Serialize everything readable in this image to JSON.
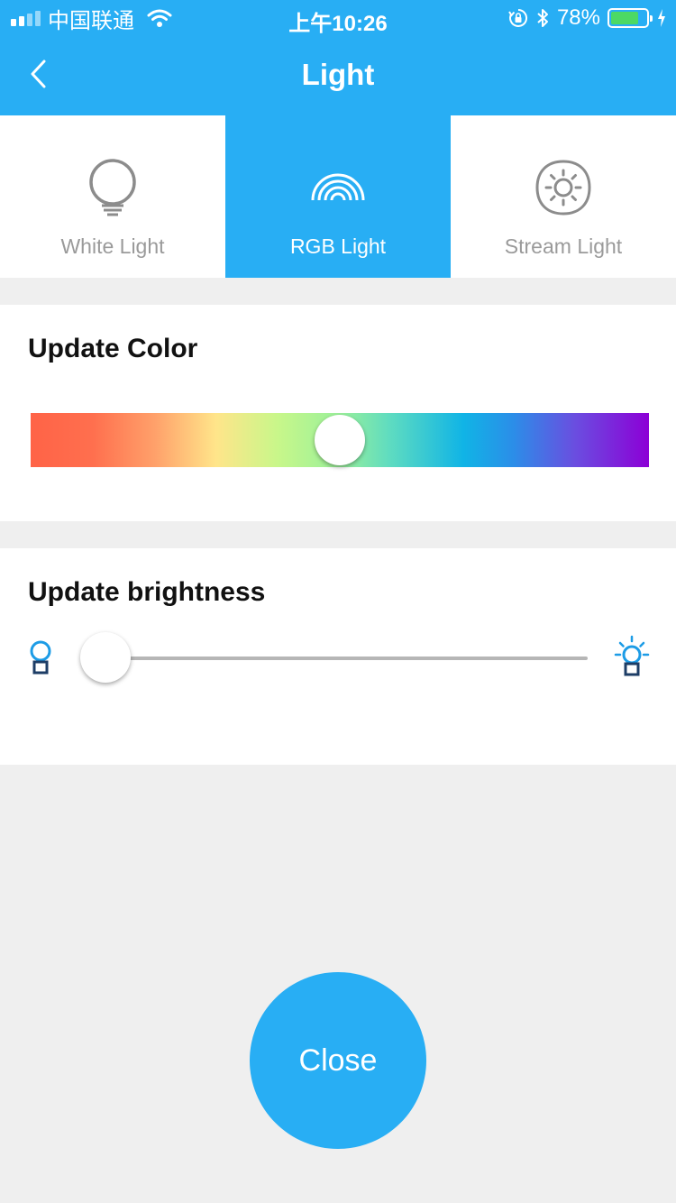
{
  "status_bar": {
    "carrier": "中国联通",
    "time": "上午10:26",
    "battery_percent": "78%",
    "battery_level": 0.78,
    "icons": [
      "signal-icon",
      "wifi-icon",
      "orientation-lock-icon",
      "bluetooth-icon",
      "battery-icon",
      "charging-icon"
    ]
  },
  "header": {
    "title": "Light",
    "back_icon": "chevron-left-icon"
  },
  "tabs": [
    {
      "label": "White Light",
      "icon": "bulb-icon",
      "active": false
    },
    {
      "label": "RGB Light",
      "icon": "rainbow-icon",
      "active": true
    },
    {
      "label": "Stream Light",
      "icon": "sun-icon",
      "active": false
    }
  ],
  "color_section": {
    "title": "Update Color",
    "hue_position": 0.5
  },
  "brightness_section": {
    "title": "Update brightness",
    "level": 0.0,
    "min_icon": "bulb-dim-icon",
    "max_icon": "bulb-bright-icon"
  },
  "close_button": {
    "label": "Close"
  },
  "colors": {
    "accent": "#28aef4",
    "background": "#efefef",
    "inactive_text": "#9a9a9a",
    "battery_fill": "#4cd964"
  }
}
